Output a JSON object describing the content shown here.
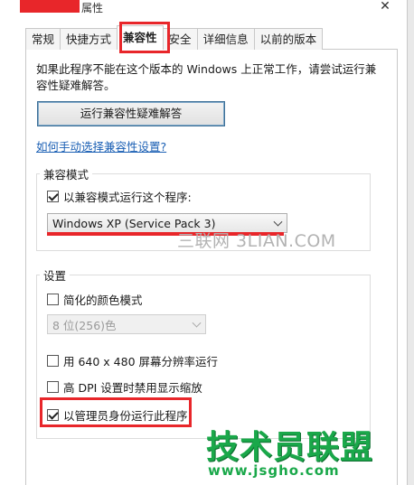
{
  "window": {
    "title": "属性",
    "close_glyph": "✕"
  },
  "tabs": [
    {
      "label": "常规"
    },
    {
      "label": "快捷方式"
    },
    {
      "label": "兼容性"
    },
    {
      "label": "安全"
    },
    {
      "label": "详细信息"
    },
    {
      "label": "以前的版本"
    }
  ],
  "compat": {
    "intro": "如果此程序不能在这个版本的 Windows 上正常工作，请尝试运行兼容性疑难解答。",
    "troubleshoot_button": "运行兼容性疑难解答",
    "manual_link": "如何手动选择兼容性设置?",
    "mode_group": {
      "label": "兼容模式",
      "checkbox_label": "以兼容模式运行这个程序:",
      "checked": true,
      "selected_os": "Windows XP (Service Pack 3)"
    },
    "settings_group": {
      "label": "设置",
      "reduced_color": {
        "label": "简化的颜色模式",
        "checked": false
      },
      "color_select": "8 位(256)色",
      "res_640": {
        "label": "用 640 x 480 屏幕分辨率运行",
        "checked": false
      },
      "high_dpi": {
        "label": "高 DPI 设置时禁用显示缩放",
        "checked": false
      },
      "run_as_admin": {
        "label": "以管理员身份运行此程序",
        "checked": true
      }
    }
  },
  "watermarks": {
    "site": "三联网 3LIAN.COM",
    "brand_cn": "技术员联盟",
    "brand_url": "www.jsgho.com"
  },
  "colors": {
    "highlight_red": "#e8262a",
    "link_blue": "#1a5fb4",
    "brand_green": "#1aa84a"
  }
}
